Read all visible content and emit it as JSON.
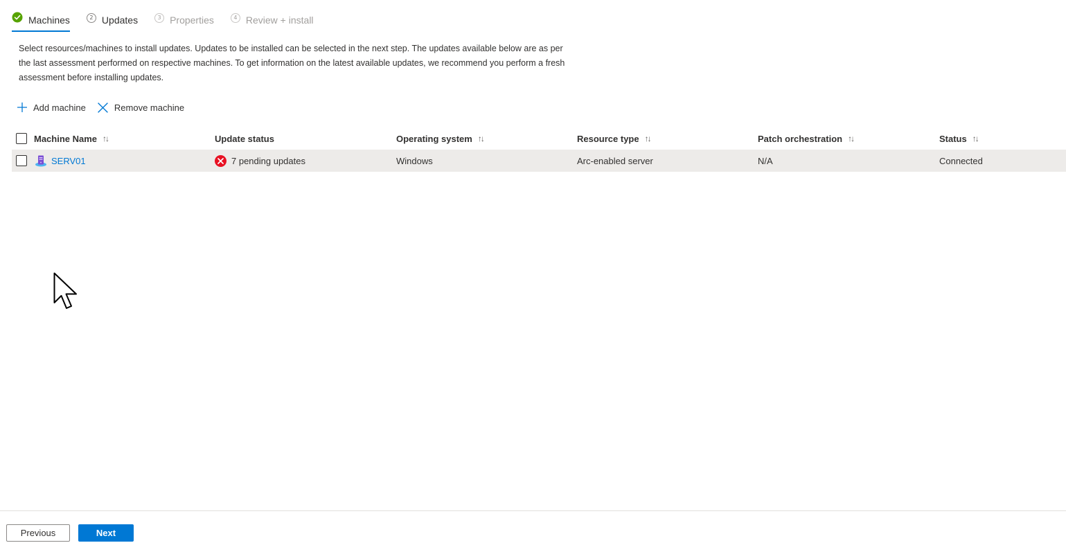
{
  "tabs": [
    {
      "label": "Machines",
      "step": "",
      "state": "active"
    },
    {
      "label": "Updates",
      "step": "2",
      "state": "enabled"
    },
    {
      "label": "Properties",
      "step": "3",
      "state": "disabled"
    },
    {
      "label": "Review + install",
      "step": "4",
      "state": "disabled"
    }
  ],
  "description": "Select resources/machines to install updates. Updates to be installed can be selected in the next step. The updates available below are as per the last assessment performed on respective machines. To get information on the latest available updates, we recommend you perform a fresh assessment before installing updates.",
  "commands": {
    "add_label": "Add machine",
    "add_icon": "plus-icon",
    "remove_label": "Remove machine",
    "remove_icon": "close-icon"
  },
  "grid": {
    "columns": [
      {
        "label": "Machine Name",
        "sortable": true
      },
      {
        "label": "Update status",
        "sortable": false
      },
      {
        "label": "Operating system",
        "sortable": true
      },
      {
        "label": "Resource type",
        "sortable": true
      },
      {
        "label": "Patch orchestration",
        "sortable": true
      },
      {
        "label": "Status",
        "sortable": true
      }
    ],
    "sort_glyph": "↑↓",
    "rows": [
      {
        "machine_name": "SERV01",
        "update_status": "7 pending updates",
        "operating_system": "Windows",
        "resource_type": "Arc-enabled server",
        "patch_orchestration": "N/A",
        "status": "Connected"
      }
    ]
  },
  "footer": {
    "previous_label": "Previous",
    "next_label": "Next"
  },
  "colors": {
    "accent": "#0078d4",
    "success": "#57a300",
    "error": "#e81123",
    "row_selected_bg": "#edebe9"
  }
}
